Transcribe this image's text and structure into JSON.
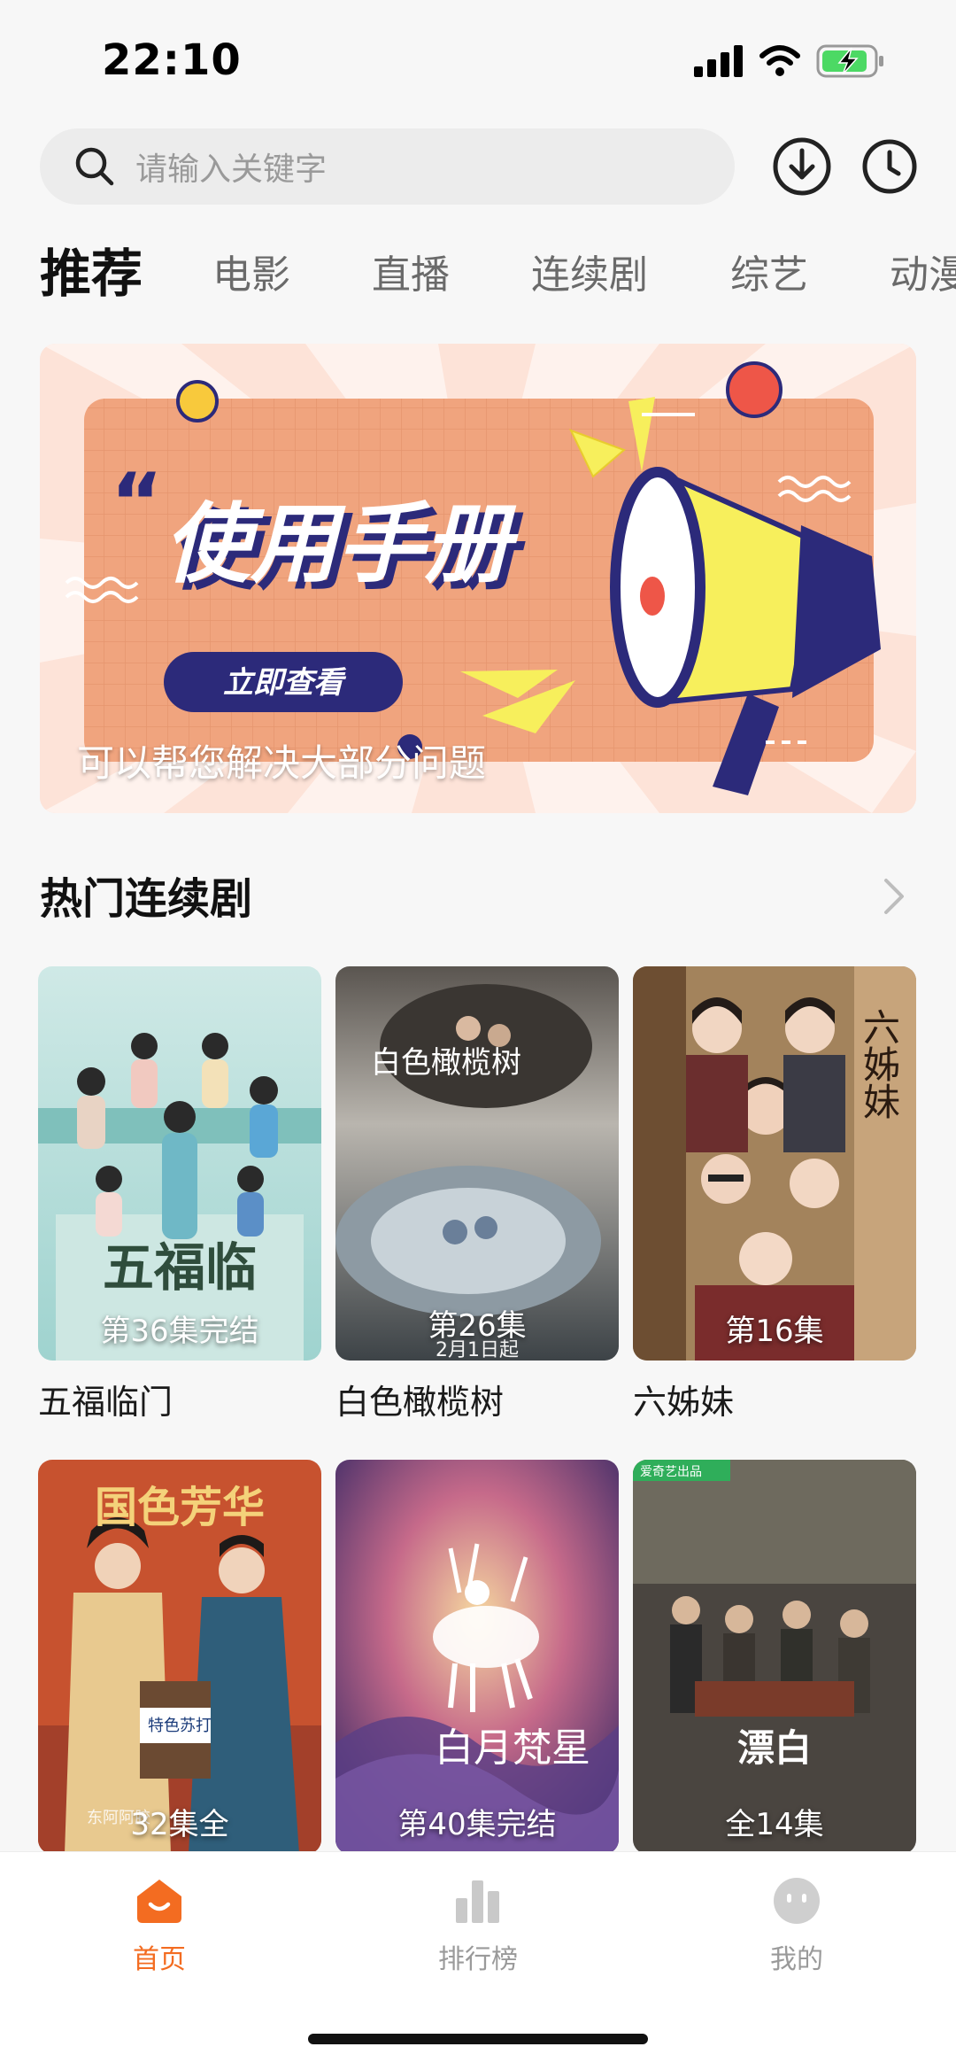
{
  "status_bar": {
    "time": "22:10"
  },
  "search": {
    "placeholder": "请输入关键字"
  },
  "tabs": [
    "推荐",
    "电影",
    "直播",
    "连续剧",
    "综艺",
    "动漫"
  ],
  "banner": {
    "headline": "使用手册",
    "button_label": "立即查看",
    "caption": "可以帮您解决大部分问题"
  },
  "section": {
    "title": "热门连续剧"
  },
  "dramas": [
    {
      "title": "五福临门",
      "episode": "第36集完结",
      "poster_text": "五福临"
    },
    {
      "title": "白色橄榄树",
      "episode": "第26集",
      "poster_text": "白色橄榄树",
      "sub": "2月1日起"
    },
    {
      "title": "六姊妹",
      "episode": "第16集",
      "poster_text": "六姊妹"
    },
    {
      "title": "",
      "episode": "32集全",
      "poster_text": "国色芳华",
      "corner": "东阿阿胶"
    },
    {
      "title": "",
      "episode": "第40集完结",
      "poster_text": "白月梵星"
    },
    {
      "title": "",
      "episode": "全14集",
      "poster_text": "漂白",
      "corner": "爱奇艺出品"
    }
  ],
  "tabbar": {
    "home": "首页",
    "ranking": "排行榜",
    "mine": "我的"
  },
  "colors": {
    "accent": "#f36c21",
    "banner_bg": "#f0a47e"
  }
}
